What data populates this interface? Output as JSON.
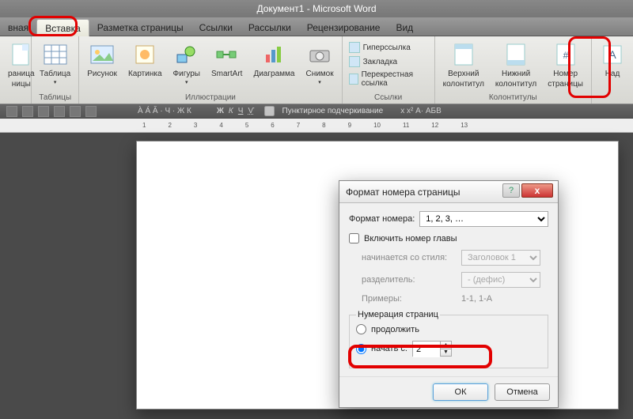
{
  "titlebar": "Документ1 - Microsoft Word",
  "tabs": [
    "вная",
    "Вставка",
    "Разметка страницы",
    "Ссылки",
    "Рассылки",
    "Рецензирование",
    "Вид"
  ],
  "active_tab_index": 1,
  "ribbon": {
    "pages": {
      "title": "",
      "item1_l1": "раница",
      "item1_l2": "ницы"
    },
    "tables": {
      "title": "Таблицы",
      "btn": "Таблица"
    },
    "illustrations": {
      "title": "Иллюстрации",
      "btns": [
        "Рисунок",
        "Картинка",
        "Фигуры",
        "SmartArt",
        "Диаграмма",
        "Снимок"
      ]
    },
    "links": {
      "title": "Ссылки",
      "items": [
        "Гиперссылка",
        "Закладка",
        "Перекрестная ссылка"
      ]
    },
    "headers_footers": {
      "title": "Колонтитулы",
      "btns": [
        [
          "Верхний",
          "колонтитул"
        ],
        [
          "Нижний",
          "колонтитул"
        ],
        [
          "Номер",
          "страницы"
        ]
      ]
    },
    "text": {
      "title": "",
      "btn": "Над"
    }
  },
  "qa": {
    "underline": "Пунктирное подчеркивание"
  },
  "ruler_marks": [
    "1",
    "·",
    "1",
    "·",
    "2",
    "·",
    "3",
    "·",
    "4",
    "·",
    "5",
    "·",
    "6",
    "·",
    "7",
    "·",
    "8",
    "·",
    "9",
    "·",
    "10",
    "·",
    "11",
    "·",
    "12",
    "·",
    "13"
  ],
  "dialog": {
    "title": "Формат номера страницы",
    "format_label": "Формат номера:",
    "format_value": "1, 2, 3, …",
    "include_chapter": "Включить номер главы",
    "starts_style_label": "начинается со стиля:",
    "starts_style_value": "Заголовок 1",
    "separator_label": "разделитель:",
    "separator_value": "-   (дефис)",
    "examples_label": "Примеры:",
    "examples_value": "1-1, 1-A",
    "numbering_legend": "Нумерация страниц",
    "continue_label": "продолжить",
    "start_at_label": "начать с:",
    "start_at_value": "2",
    "ok": "ОК",
    "cancel": "Отмена"
  }
}
